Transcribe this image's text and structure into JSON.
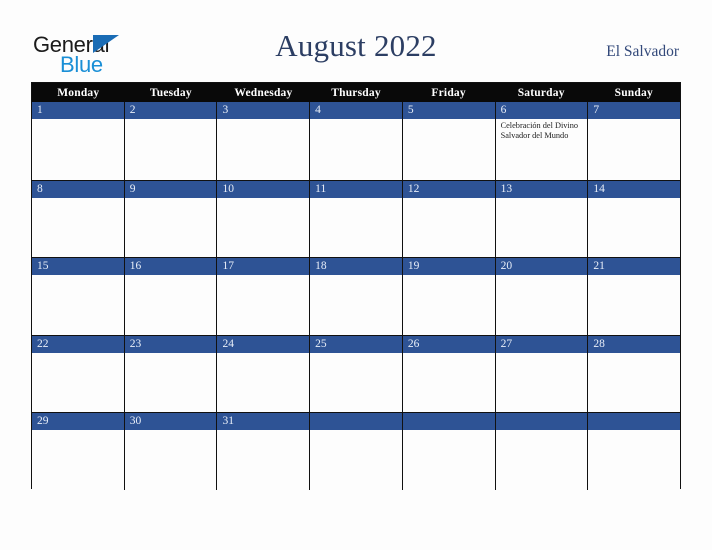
{
  "brand": {
    "name_dark": "General",
    "name_blue": "Blue",
    "triangle_color": "#1a6cb5",
    "blue_text_color": "#1a8fd6"
  },
  "header": {
    "title": "August 2022",
    "country": "El Salvador",
    "title_color": "#2c3e63"
  },
  "calendar": {
    "weekday_headers": [
      "Monday",
      "Tuesday",
      "Wednesday",
      "Thursday",
      "Friday",
      "Saturday",
      "Sunday"
    ],
    "header_bg": "#090909",
    "daynum_bg": "#2e5395",
    "weeks": [
      [
        {
          "day": "1",
          "events": []
        },
        {
          "day": "2",
          "events": []
        },
        {
          "day": "3",
          "events": []
        },
        {
          "day": "4",
          "events": []
        },
        {
          "day": "5",
          "events": []
        },
        {
          "day": "6",
          "events": [
            "Celebración del Divino Salvador del Mundo"
          ]
        },
        {
          "day": "7",
          "events": []
        }
      ],
      [
        {
          "day": "8",
          "events": []
        },
        {
          "day": "9",
          "events": []
        },
        {
          "day": "10",
          "events": []
        },
        {
          "day": "11",
          "events": []
        },
        {
          "day": "12",
          "events": []
        },
        {
          "day": "13",
          "events": []
        },
        {
          "day": "14",
          "events": []
        }
      ],
      [
        {
          "day": "15",
          "events": []
        },
        {
          "day": "16",
          "events": []
        },
        {
          "day": "17",
          "events": []
        },
        {
          "day": "18",
          "events": []
        },
        {
          "day": "19",
          "events": []
        },
        {
          "day": "20",
          "events": []
        },
        {
          "day": "21",
          "events": []
        }
      ],
      [
        {
          "day": "22",
          "events": []
        },
        {
          "day": "23",
          "events": []
        },
        {
          "day": "24",
          "events": []
        },
        {
          "day": "25",
          "events": []
        },
        {
          "day": "26",
          "events": []
        },
        {
          "day": "27",
          "events": []
        },
        {
          "day": "28",
          "events": []
        }
      ],
      [
        {
          "day": "29",
          "events": []
        },
        {
          "day": "30",
          "events": []
        },
        {
          "day": "31",
          "events": []
        },
        {
          "day": "",
          "events": []
        },
        {
          "day": "",
          "events": []
        },
        {
          "day": "",
          "events": []
        },
        {
          "day": "",
          "events": []
        }
      ]
    ]
  }
}
